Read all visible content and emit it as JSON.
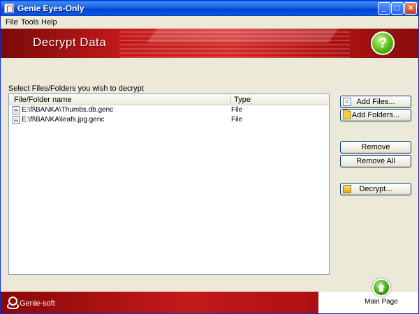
{
  "window": {
    "title": "Genie Eyes-Only"
  },
  "menu": {
    "items": [
      "File",
      "Tools",
      "Help"
    ]
  },
  "banner": {
    "title": "Decrypt Data",
    "help_symbol": "?"
  },
  "instructions": "Select Files/Folders you wish to decrypt",
  "list": {
    "columns": [
      "File/Folder name",
      "Type"
    ],
    "rows": [
      {
        "name": "E:\\fl\\BANKA\\Thumbs.db.genc",
        "type": "File"
      },
      {
        "name": "E:\\fl\\BANKA\\leafs.jpg.genc",
        "type": "File"
      }
    ]
  },
  "buttons": {
    "add_files": "Add Files...",
    "add_folders": "Add Folders...",
    "remove": "Remove",
    "remove_all": "Remove All",
    "decrypt": "Decrypt..."
  },
  "footer": {
    "logo": "Genie-soft",
    "main_page": "Main Page"
  },
  "colors": {
    "banner_red": "#c61a1a",
    "titlebar_blue": "#0046d5",
    "accent_green": "#3aa010"
  },
  "icons": {
    "app": "app-icon",
    "help": "help-icon",
    "file": "file-icon",
    "folder": "folder-icon",
    "decrypt": "decrypt-icon",
    "home": "home-icon",
    "logo": "genie-logo-icon"
  }
}
